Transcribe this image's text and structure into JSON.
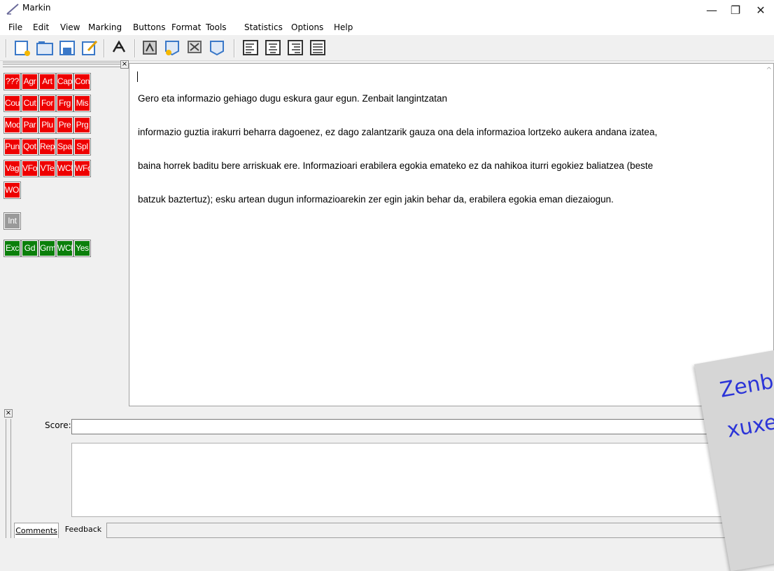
{
  "window": {
    "title": "Markin",
    "minimize": "—",
    "restore": "❐",
    "close": "✕"
  },
  "menu": [
    "File",
    "Edit",
    "View",
    "Marking",
    "Buttons",
    "Format",
    "Tools",
    "Statistics",
    "Options",
    "Help"
  ],
  "toolbar": {
    "buttons": [
      "new",
      "open",
      "save",
      "edit",
      "mark-tool",
      "mark-a",
      "mark-b",
      "mark-c",
      "mark-d",
      "align-left",
      "align-center",
      "align-right",
      "justify"
    ]
  },
  "marking_buttons": {
    "red": [
      "???",
      "Agr",
      "Art",
      "Cap",
      "Con",
      "Cou",
      "Cut",
      "For",
      "Frg",
      "Mis",
      "Mod",
      "Par",
      "Plu",
      "Pre",
      "Prg",
      "Pun",
      "Qot",
      "Rep",
      "Spa",
      "Spl",
      "Vag",
      "VFo",
      "VTe",
      "WCh",
      "WFo",
      "WOr"
    ],
    "grey": [
      "Int"
    ],
    "green": [
      "Exc",
      "Gd",
      "Grm",
      "WCh",
      "Yes"
    ],
    "colors": {
      "red": "#ee0000",
      "grey": "#9a9a9a",
      "green": "#0a7f0a"
    }
  },
  "editor": {
    "line1": "Gero eta informazio gehiago dugu eskura gaur egun. Zenbait langintzatan",
    "line2": "informazio guztia irakurri beharra dagoenez, ez dago zalantzarik gauza ona dela informazioa lortzeko aukera andana izatea,",
    "line3": "baina horrek baditu bere arriskuak ere. Informazioari erabilera egokia emateko ez da nahikoa iturri egokiez baliatzea (beste",
    "line4": "batzuk baztertuz); esku artean dugun informazioarekin zer egin jakin behar da, erabilera egokia eman diezaiogun."
  },
  "bottom": {
    "score_label": "Score:",
    "tabs": {
      "comments": "Comments",
      "feedback": "Feedback"
    }
  },
  "overlay": {
    "line1": "Zenb",
    "line2": "xuxe"
  }
}
